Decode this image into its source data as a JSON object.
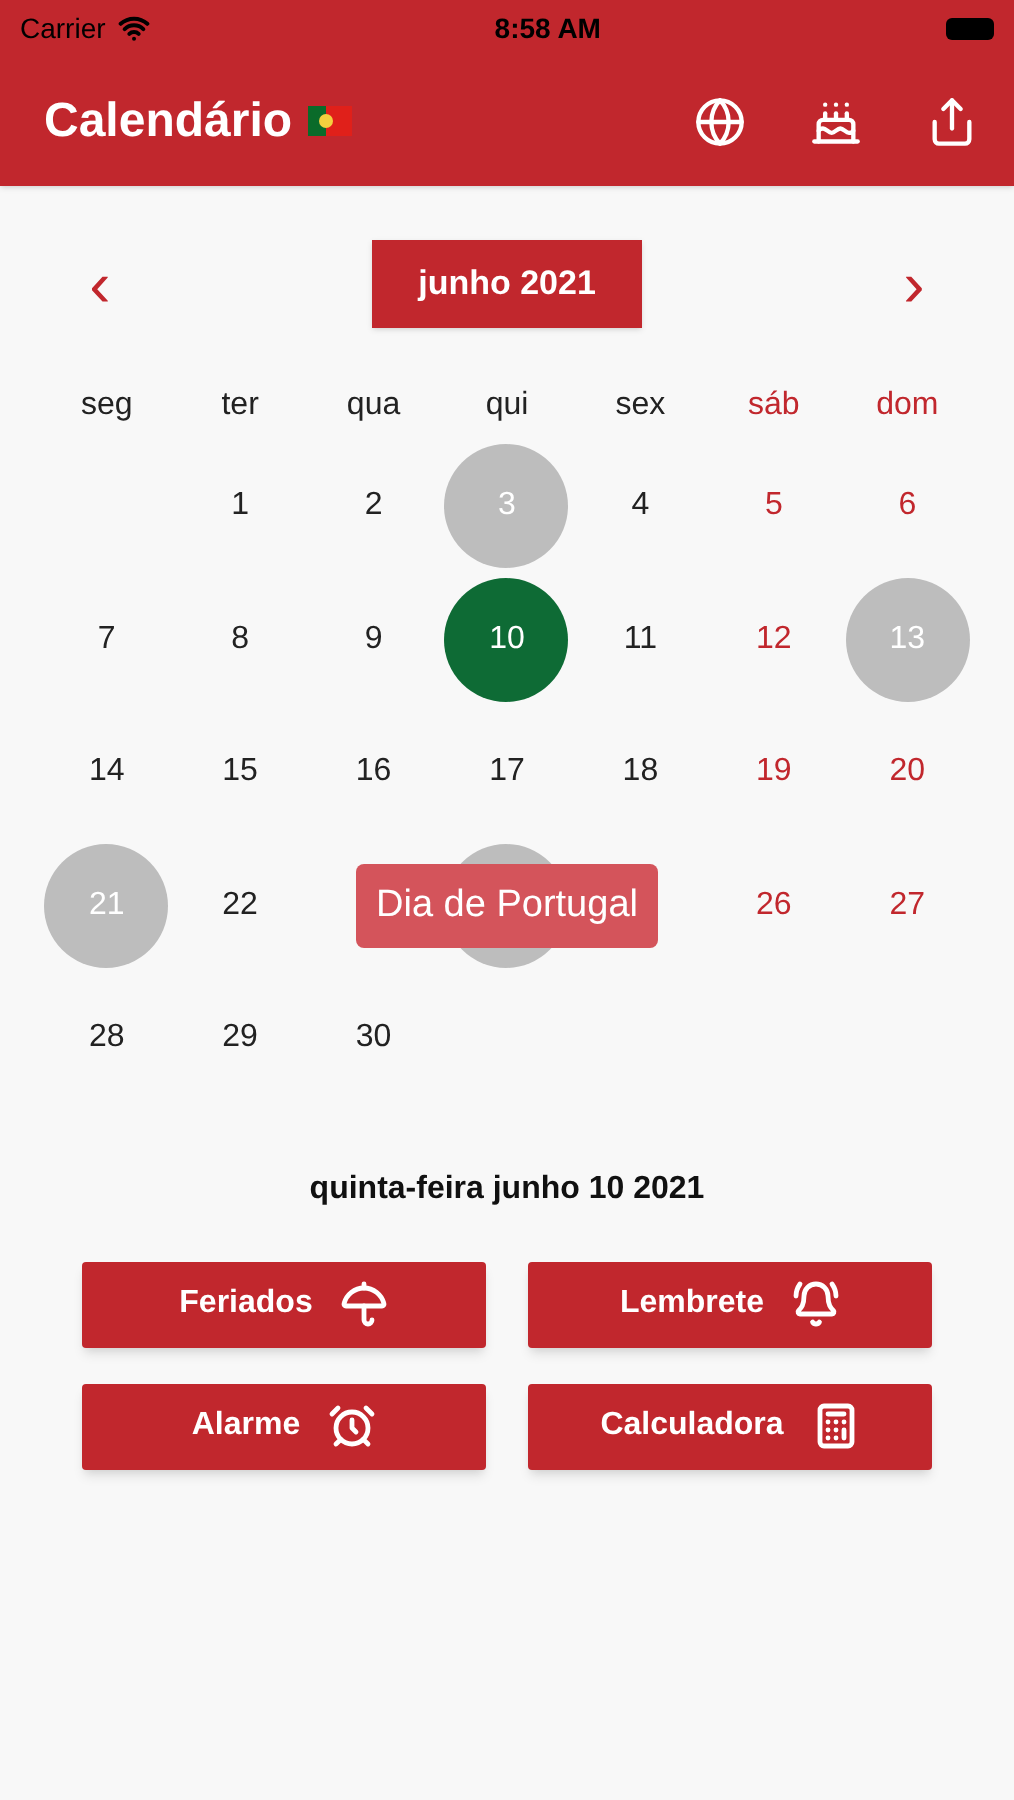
{
  "status_bar": {
    "carrier": "Carrier",
    "time": "8:58 AM"
  },
  "nav": {
    "title": "Calendário"
  },
  "month": {
    "prev": "‹",
    "label": "junho 2021",
    "next": "›"
  },
  "weekdays": [
    {
      "label": "seg",
      "weekend": false
    },
    {
      "label": "ter",
      "weekend": false
    },
    {
      "label": "qua",
      "weekend": false
    },
    {
      "label": "qui",
      "weekend": false
    },
    {
      "label": "sex",
      "weekend": false
    },
    {
      "label": "sáb",
      "weekend": true
    },
    {
      "label": "dom",
      "weekend": true
    }
  ],
  "weeks": [
    {
      "days": [
        {
          "kind": "blank"
        },
        {
          "kind": "day",
          "day": "1"
        },
        {
          "kind": "day",
          "day": "2"
        },
        {
          "kind": "day",
          "day": "3",
          "holiday": true
        },
        {
          "kind": "day",
          "day": "4"
        },
        {
          "kind": "day",
          "day": "5"
        },
        {
          "kind": "day",
          "day": "6"
        }
      ]
    },
    {
      "days": [
        {
          "kind": "day",
          "day": "7"
        },
        {
          "kind": "day",
          "day": "8"
        },
        {
          "kind": "day",
          "day": "9"
        },
        {
          "kind": "day",
          "day": "10",
          "selected": true
        },
        {
          "kind": "day",
          "day": "11"
        },
        {
          "kind": "day",
          "day": "12"
        },
        {
          "kind": "day",
          "day": "13",
          "holiday": true
        }
      ]
    },
    {
      "days": [
        {
          "kind": "day",
          "day": "14"
        },
        {
          "kind": "day",
          "day": "15"
        },
        {
          "kind": "day",
          "day": "16"
        },
        {
          "kind": "day",
          "day": "17"
        },
        {
          "kind": "day",
          "day": "18"
        },
        {
          "kind": "day",
          "day": "19"
        },
        {
          "kind": "day",
          "day": "20"
        }
      ]
    },
    {
      "days": [
        {
          "kind": "day",
          "day": "21",
          "holiday": true
        },
        {
          "kind": "day",
          "day": "22"
        },
        {
          "kind": "blank"
        },
        {
          "kind": "covered",
          "holiday": true
        },
        {
          "kind": "blank"
        },
        {
          "kind": "day",
          "day": "26"
        },
        {
          "kind": "day",
          "day": "27"
        }
      ],
      "tooltip": "Dia de Portugal"
    },
    {
      "days": [
        {
          "kind": "day",
          "day": "28"
        },
        {
          "kind": "day",
          "day": "29"
        },
        {
          "kind": "day",
          "day": "30"
        },
        {
          "kind": "blank"
        },
        {
          "kind": "blank"
        },
        {
          "kind": "blank"
        },
        {
          "kind": "blank"
        }
      ]
    }
  ],
  "selected_date": "quinta-feira junho 10 2021",
  "buttons": [
    {
      "label": "Feriados",
      "kind": "holidays"
    },
    {
      "label": "Lembrete",
      "kind": "reminder"
    },
    {
      "label": "Alarme",
      "kind": "alarm"
    },
    {
      "label": "Calculadora",
      "kind": "calculator"
    }
  ]
}
